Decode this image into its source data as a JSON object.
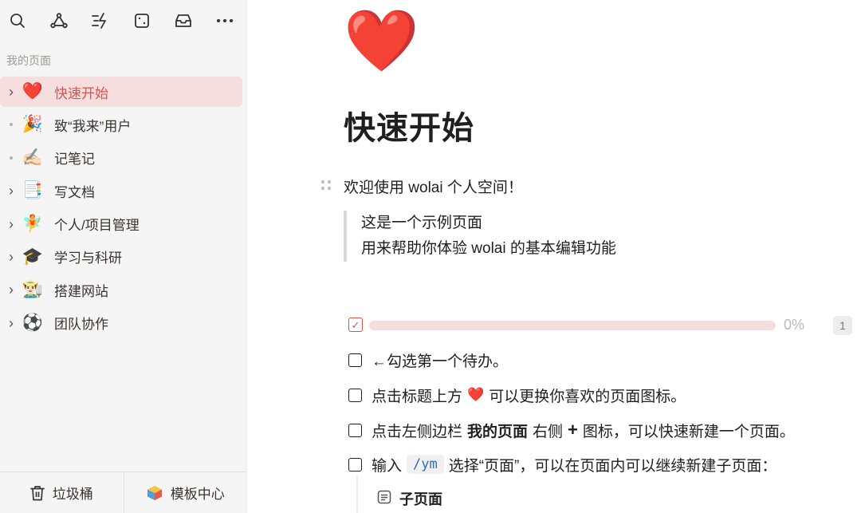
{
  "sidebar": {
    "toolbar": [
      {
        "name": "search-icon"
      },
      {
        "name": "graph-icon"
      },
      {
        "name": "quick-capture-icon"
      },
      {
        "name": "dice-icon"
      },
      {
        "name": "inbox-icon"
      },
      {
        "name": "more-icon"
      }
    ],
    "section_title": "我的页面",
    "items": [
      {
        "label": "快速开始",
        "emoji": "❤️",
        "expandable": true,
        "active": true
      },
      {
        "label": "致“我来”用户",
        "emoji": "🎉",
        "expandable": false,
        "active": false
      },
      {
        "label": "记笔记",
        "emoji": "✍🏻",
        "expandable": false,
        "active": false
      },
      {
        "label": "写文档",
        "emoji": "📑",
        "expandable": true,
        "active": false
      },
      {
        "label": "个人/项目管理",
        "emoji": "🧚",
        "expandable": true,
        "active": false
      },
      {
        "label": "学习与科研",
        "emoji": "🎓",
        "expandable": true,
        "active": false
      },
      {
        "label": "搭建网站",
        "emoji": "👨🏻‍🌾",
        "expandable": true,
        "active": false
      },
      {
        "label": "团队协作",
        "emoji": "⚽",
        "expandable": true,
        "active": false
      }
    ],
    "footer": {
      "trash_label": "垃圾桶",
      "templates_label": "模板中心"
    }
  },
  "page": {
    "icon": "❤️",
    "title": "快速开始",
    "welcome": "欢迎使用 wolai 个人空间！",
    "quote_line1": "这是一个示例页面",
    "quote_line2": "用来帮助你体验 wolai 的基本编辑功能",
    "progress": {
      "percent_text": "0%",
      "fraction": 0,
      "count": "1"
    },
    "todos": {
      "t1": "←勾选第一个待办。",
      "t2_pre": "点击标题上方",
      "t2_emoji": "❤️",
      "t2_post": "可以更换你喜欢的页面图标。",
      "t3_pre": "点击左侧边栏",
      "t3_bold": "我的页面",
      "t3_mid": "右侧",
      "t3_plus": "+",
      "t3_post": "图标，可以快速新建一个页面。",
      "t4_pre": "输入",
      "t4_code": "/ym",
      "t4_post": "选择“页面”，可以在页面内可以继续新建子页面："
    },
    "subpage_label": "子页面"
  },
  "colors": {
    "accent": "#d8534d",
    "active_bg": "#f5dedd",
    "sidebar_bg": "#f5f5f5"
  }
}
